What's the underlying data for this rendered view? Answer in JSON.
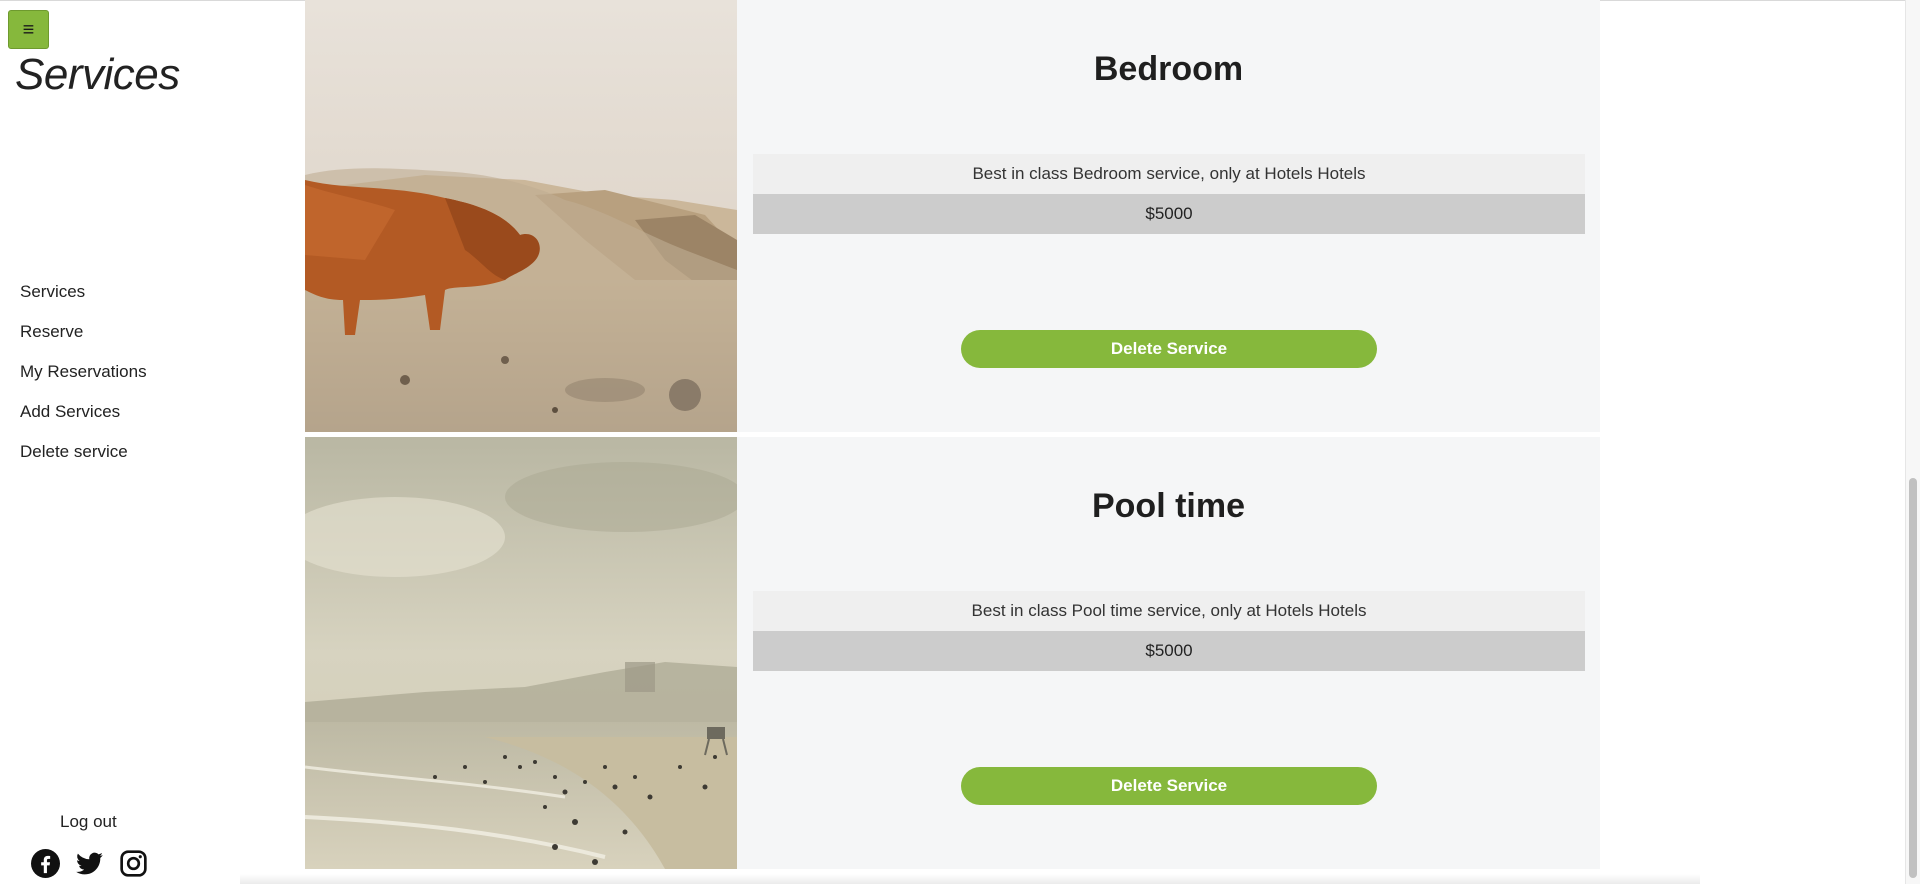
{
  "sidebar": {
    "menu_glyph": "≡",
    "title": "Services",
    "nav": [
      "Services",
      "Reserve",
      "My Reservations",
      "Add Services",
      "Delete service"
    ],
    "logout": "Log out",
    "social_icons": [
      "facebook-icon",
      "twitter-icon",
      "instagram-icon"
    ]
  },
  "services": [
    {
      "title": "Bedroom",
      "description": "Best in class Bedroom service, only at Hotels Hotels",
      "price": "$5000",
      "button": "Delete Service"
    },
    {
      "title": "Pool time",
      "description": "Best in class Pool time service, only at Hotels Hotels",
      "price": "$5000",
      "button": "Delete Service"
    }
  ],
  "colors": {
    "accent": "#86b83c",
    "card_bg": "#f5f6f7",
    "price_bg": "#cccccc",
    "desc_bg": "#efefef"
  }
}
